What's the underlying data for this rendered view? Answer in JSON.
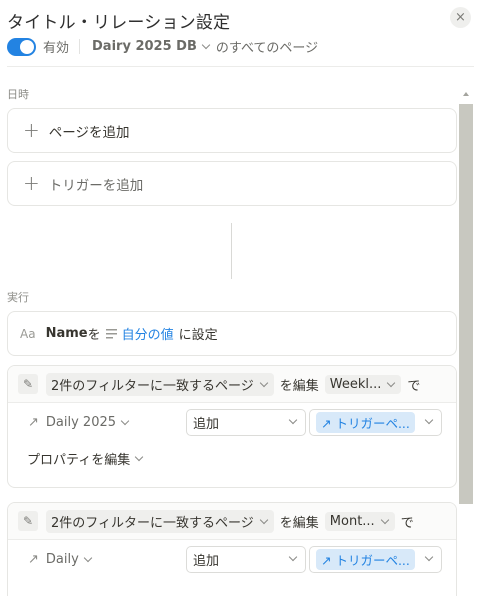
{
  "header": {
    "title": "タイトル・リレーション設定",
    "close_label": "×",
    "enabled_label": "有効",
    "database_name": "Dairy 2025 DB",
    "scope_text": "のすべてのページ"
  },
  "when_section": {
    "label": "日時",
    "add_page": "ページを追加",
    "add_trigger": "トリガーを追加"
  },
  "do_section": {
    "label": "実行",
    "set_action": {
      "type_icon": "Aa",
      "property": "Name",
      "particle": "を",
      "value": "自分の値",
      "suffix": "に設定"
    },
    "edit_actions": [
      {
        "filter_label": "2件のフィルターに一致するページ",
        "edit_text": "を編集",
        "target_db": "Weekl...",
        "de": "で",
        "relation": "Daily 2025",
        "operation": "追加",
        "value": "トリガーペ...",
        "edit_props": "プロパティを編集"
      },
      {
        "filter_label": "2件のフィルターに一致するページ",
        "edit_text": "を編集",
        "target_db": "Mont...",
        "de": "で",
        "relation": "Daily",
        "operation": "追加",
        "value": "トリガーペ..."
      }
    ]
  },
  "colors": {
    "accent": "#2383e2",
    "chip_bg": "#d8e9f9",
    "scrollbar": "#c8c8c0"
  }
}
